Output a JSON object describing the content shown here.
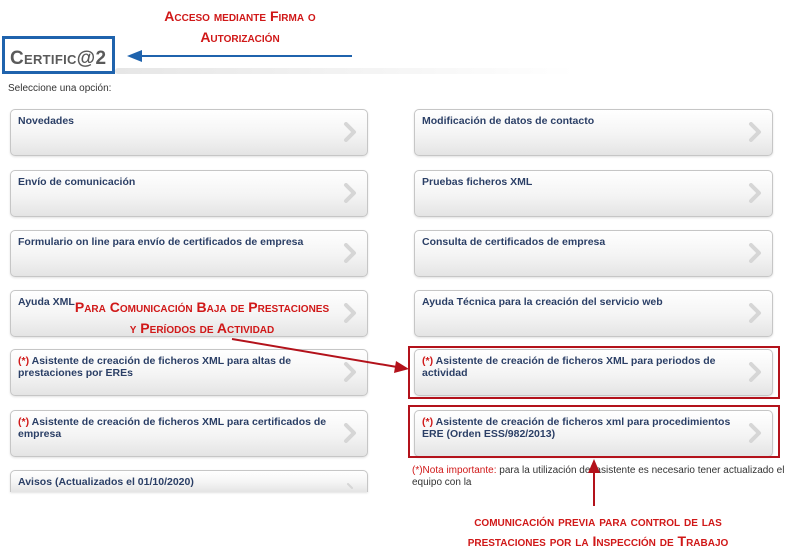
{
  "header": {
    "logo_text": "Certific@2",
    "subtitle": "Seleccione una opción:"
  },
  "annotations": {
    "top_line1": "Acceso mediante Firma o",
    "top_line2": "Autorización",
    "middle_line1": "Para Comunicación Baja de Prestaciones",
    "middle_line2": "y Períodos de Actividad",
    "bottom_line1": "comunicación previa para control de las",
    "bottom_line2": "prestaciones por la Inspección de Trabajo"
  },
  "options_left": [
    {
      "prefix": "",
      "label": "Novedades"
    },
    {
      "prefix": "",
      "label": "Envío de comunicación"
    },
    {
      "prefix": "",
      "label": "Formulario on line para envío de certificados de empresa"
    },
    {
      "prefix": "",
      "label": "Ayuda XML"
    },
    {
      "prefix": "(*)",
      "label": " Asistente de creación de ficheros XML para altas de prestaciones por EREs"
    },
    {
      "prefix": "(*)",
      "label": " Asistente de creación de ficheros XML para certificados de empresa"
    },
    {
      "prefix": "",
      "label": "Avisos (Actualizados el 01/10/2020)"
    }
  ],
  "options_right": [
    {
      "prefix": "",
      "label": "Modificación de datos de contacto"
    },
    {
      "prefix": "",
      "label": "Pruebas ficheros XML"
    },
    {
      "prefix": "",
      "label": "Consulta de certificados de empresa"
    },
    {
      "prefix": "",
      "label": "Ayuda Técnica para la creación del servicio web"
    },
    {
      "prefix": "(*)",
      "label": " Asistente de creación de ficheros XML para periodos de actividad"
    },
    {
      "prefix": "(*)",
      "label": " Asistente de creación de ficheros xml para procedimientos ERE (Orden ESS/982/2013)"
    }
  ],
  "note": {
    "prefix": "(*)Nota importante:",
    "text": " para la utilización del asistente es necesario tener actualizado el equipo con la"
  },
  "colors": {
    "annotation_red": "#d01818",
    "logo_border": "#1f63ad",
    "arrow_blue": "#1f63ad",
    "highlight_border": "#b3121b",
    "button_text": "#2b3f66"
  },
  "icons": {
    "button_chevron": "chevron-right-icon",
    "pointer_arrow": "arrow-icon"
  }
}
